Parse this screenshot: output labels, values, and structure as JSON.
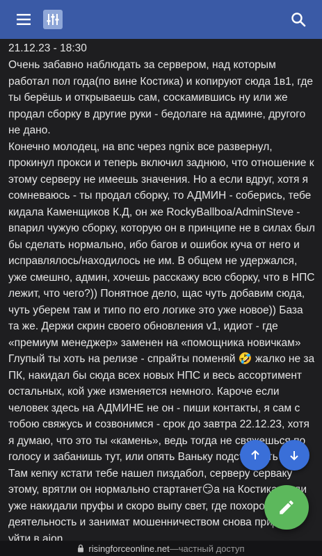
{
  "colors": {
    "appbar": "#3a5aa6",
    "background": "#1e1e20",
    "fab_small": "#3a6fd8",
    "fab_edit": "#5cb85c"
  },
  "header": {
    "menu_icon": "hamburger-icon",
    "logo_icon": "sliders-logo-icon",
    "search_icon": "search-icon"
  },
  "post": {
    "date": "21.12.23 - 18:30",
    "part1": "Очень забавно наблюдать за сервером, над которым работал пол года(по вине Костика) и копируют сюда 1в1, где ты берёшь и открываешь сам, соскамившись ну или же продал сборку в другие руки - бедолаге на админе, другого не дано.\nКонечно молодец, на впс через ngnix все развернул, прокинул прокси и теперь включил заднюю, что отношение к этому серверу не имеешь значения. Но а если вдруг, хотя я сомневаюсь - ты продал сборку, то АДМИН - соберись, тебе кидала Каменщиков К.Д, он же RockyBallboa/AdminSteve - впарил чужую сборку, которую он в принципе не в силах был бы сделать нормально, ибо багов и ошибок куча от него и исправлялось/находилось не им. В общем не удержался, уже смешно, админ, хочешь расскажу всю сборку, что в НПС лежит, что чего?)) Понятное дело, щас чуть добавим сюда, чуть уберем там и типо по его логике это уже новое)) База та же. Держи скрин своего обновления v1, идиот - где «премиум менеджер» заменен на «помощника новичкам» Глупый ты хоть на релизе - спрайты поменяй ",
    "emoji1": "🤣",
    "part2": " жалко не за ПК, накидал бы сюда всех новых НПС и весь ассортимент остальных, кой уже изменяется немного. Кароче если человек здесь на АДМИНЕ не он - пиши контакты, я сам с тобою свяжусь и созвонимся - срок до завтра 22.12.23, хотя я думаю, что это ты «камень», ведь тогда не свяжешься по голосу и забанишь тут, или опять Ваньку подставлять ",
    "part3": "его? Там кепку кстати тебе нашел пиздабол, серверу серваку этому, врятли он нормально стартанет",
    "emoji2": "😏",
    "part4": "а на Костика люди уже накидали пруфы и скоро выпу свет, где похоронят его деятельность и занимат мошенничеством снова придется уйти в aion."
  },
  "fabs": {
    "scroll_up_icon": "arrow-up-icon",
    "scroll_down_icon": "arrow-down-icon",
    "edit_icon": "pencil-icon"
  },
  "urlbar": {
    "domain": "risingforceonline.net",
    "separator": " — ",
    "mode": "частный доступ"
  }
}
